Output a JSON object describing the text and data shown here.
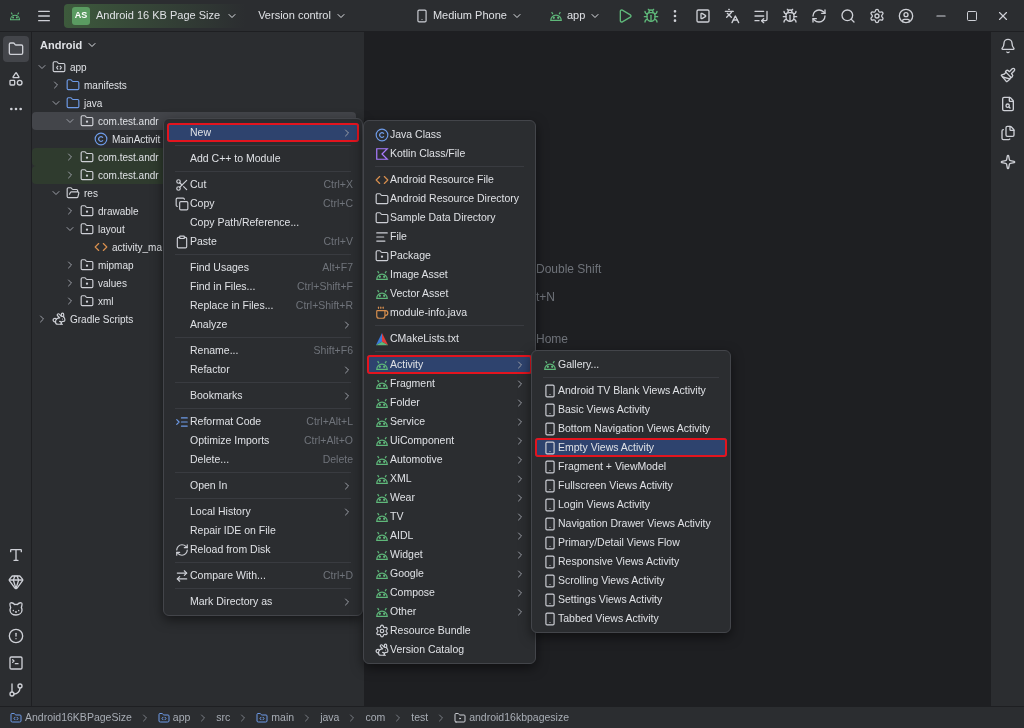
{
  "title_bar": {
    "project_badge": "AS",
    "project_name": "Android 16 KB Page Size",
    "vcs": "Version control",
    "device": "Medium Phone",
    "run_config": "app"
  },
  "tool_strip": [
    {
      "selected": true
    },
    {
      "selected": false
    },
    {
      "selected": false
    }
  ],
  "project_panel": {
    "view": "Android",
    "tree": [
      {
        "label": "app",
        "kind": "module",
        "expanded": true,
        "selected": false,
        "highlighted": false,
        "children": [
          {
            "label": "manifests",
            "kind": "folder",
            "expanded": false,
            "selected": false,
            "highlighted": false
          },
          {
            "label": "java",
            "kind": "folder",
            "expanded": true,
            "selected": false,
            "highlighted": false,
            "children": [
              {
                "label": "com.test.andr",
                "kind": "package",
                "expanded": true,
                "selected": true,
                "highlighted": false,
                "children": [
                  {
                    "label": "MainActivit",
                    "kind": "class",
                    "selected": false,
                    "highlighted": false
                  }
                ]
              },
              {
                "label": "com.test.andr",
                "kind": "package",
                "expanded": false,
                "selected": false,
                "highlighted": true
              },
              {
                "label": "com.test.andr",
                "kind": "package",
                "expanded": false,
                "selected": false,
                "highlighted": true
              }
            ]
          },
          {
            "label": "res",
            "kind": "resfolder",
            "expanded": true,
            "selected": false,
            "highlighted": false,
            "children": [
              {
                "label": "drawable",
                "kind": "package",
                "expanded": false,
                "selected": false,
                "highlighted": false
              },
              {
                "label": "layout",
                "kind": "package",
                "expanded": true,
                "selected": false,
                "highlighted": false,
                "children": [
                  {
                    "label": "activity_ma",
                    "kind": "xml",
                    "selected": false,
                    "highlighted": false
                  }
                ]
              },
              {
                "label": "mipmap",
                "kind": "package",
                "expanded": false,
                "selected": false,
                "highlighted": false
              },
              {
                "label": "values",
                "kind": "package",
                "expanded": false,
                "selected": false,
                "highlighted": false
              },
              {
                "label": "xml",
                "kind": "package",
                "expanded": false,
                "selected": false,
                "highlighted": false
              }
            ]
          }
        ]
      },
      {
        "label": "Gradle Scripts",
        "kind": "gradle",
        "expanded": false,
        "selected": false,
        "highlighted": false
      }
    ]
  },
  "editor_hints": [
    "Double Shift",
    "t+N",
    "Home"
  ],
  "menus": [
    {
      "sections": [
        {
          "items": [
            {
              "label": "New",
              "submenu": true,
              "selected": true,
              "outlined": true
            }
          ]
        },
        {
          "items": [
            {
              "label": "Add C++ to Module",
              "submenu": false,
              "selected": false,
              "outlined": false
            }
          ]
        },
        {
          "items": [
            {
              "label": "Cut",
              "shortcut": "Ctrl+X",
              "kind": "scissors",
              "submenu": false,
              "selected": false,
              "outlined": false
            },
            {
              "label": "Copy",
              "shortcut": "Ctrl+C",
              "kind": "copy",
              "submenu": false,
              "selected": false,
              "outlined": false
            },
            {
              "label": "Copy Path/Reference...",
              "submenu": false,
              "selected": false,
              "outlined": false
            },
            {
              "label": "Paste",
              "shortcut": "Ctrl+V",
              "kind": "paste",
              "submenu": false,
              "selected": false,
              "outlined": false
            }
          ]
        },
        {
          "items": [
            {
              "label": "Find Usages",
              "shortcut": "Alt+F7",
              "submenu": false,
              "selected": false,
              "outlined": false
            },
            {
              "label": "Find in Files...",
              "shortcut": "Ctrl+Shift+F",
              "submenu": false,
              "selected": false,
              "outlined": false
            },
            {
              "label": "Replace in Files...",
              "shortcut": "Ctrl+Shift+R",
              "submenu": false,
              "selected": false,
              "outlined": false
            },
            {
              "label": "Analyze",
              "submenu": true,
              "selected": false,
              "outlined": false
            }
          ]
        },
        {
          "items": [
            {
              "label": "Rename...",
              "shortcut": "Shift+F6",
              "submenu": false,
              "selected": false,
              "outlined": false
            },
            {
              "label": "Refactor",
              "submenu": true,
              "selected": false,
              "outlined": false
            }
          ]
        },
        {
          "items": [
            {
              "label": "Bookmarks",
              "submenu": true,
              "selected": false,
              "outlined": false
            }
          ]
        },
        {
          "items": [
            {
              "label": "Reformat Code",
              "shortcut": "Ctrl+Alt+L",
              "kind": "reformat",
              "submenu": false,
              "selected": false,
              "outlined": false
            },
            {
              "label": "Optimize Imports",
              "shortcut": "Ctrl+Alt+O",
              "submenu": false,
              "selected": false,
              "outlined": false
            },
            {
              "label": "Delete...",
              "shortcut": "Delete",
              "submenu": false,
              "selected": false,
              "outlined": false
            }
          ]
        },
        {
          "items": [
            {
              "label": "Open In",
              "submenu": true,
              "selected": false,
              "outlined": false
            }
          ]
        },
        {
          "items": [
            {
              "label": "Local History",
              "submenu": true,
              "selected": false,
              "outlined": false
            },
            {
              "label": "Repair IDE on File",
              "submenu": false,
              "selected": false,
              "outlined": false
            },
            {
              "label": "Reload from Disk",
              "kind": "reload",
              "submenu": false,
              "selected": false,
              "outlined": false
            }
          ]
        },
        {
          "items": [
            {
              "label": "Compare With...",
              "shortcut": "Ctrl+D",
              "kind": "compare",
              "submenu": false,
              "selected": false,
              "outlined": false
            }
          ]
        },
        {
          "items": [
            {
              "label": "Mark Directory as",
              "submenu": true,
              "selected": false,
              "outlined": false
            }
          ]
        }
      ]
    },
    {
      "sections": [
        {
          "items": [
            {
              "label": "Java Class",
              "kind": "class",
              "submenu": false,
              "selected": false,
              "outlined": false
            },
            {
              "label": "Kotlin Class/File",
              "kind": "kotlin",
              "submenu": false,
              "selected": false,
              "outlined": false
            }
          ]
        },
        {
          "items": [
            {
              "label": "Android Resource File",
              "kind": "xml",
              "submenu": false,
              "selected": false,
              "outlined": false
            },
            {
              "label": "Android Resource Directory",
              "kind": "folder",
              "submenu": false,
              "selected": false,
              "outlined": false
            },
            {
              "label": "Sample Data Directory",
              "kind": "folder",
              "submenu": false,
              "selected": false,
              "outlined": false
            },
            {
              "label": "File",
              "kind": "file",
              "submenu": false,
              "selected": false,
              "outlined": false
            },
            {
              "label": "Package",
              "kind": "package",
              "submenu": false,
              "selected": false,
              "outlined": false
            },
            {
              "label": "Image Asset",
              "kind": "android",
              "submenu": false,
              "selected": false,
              "outlined": false
            },
            {
              "label": "Vector Asset",
              "kind": "android",
              "submenu": false,
              "selected": false,
              "outlined": false
            },
            {
              "label": "module-info.java",
              "kind": "java",
              "submenu": false,
              "selected": false,
              "outlined": false
            }
          ]
        },
        {
          "items": [
            {
              "label": "CMakeLists.txt",
              "kind": "cmake",
              "submenu": false,
              "selected": false,
              "outlined": false
            }
          ]
        },
        {
          "items": [
            {
              "label": "Activity",
              "kind": "android",
              "submenu": true,
              "selected": true,
              "outlined": true
            },
            {
              "label": "Fragment",
              "kind": "android",
              "submenu": true,
              "selected": false,
              "outlined": false
            },
            {
              "label": "Folder",
              "kind": "android",
              "submenu": true,
              "selected": false,
              "outlined": false
            },
            {
              "label": "Service",
              "kind": "android",
              "submenu": true,
              "selected": false,
              "outlined": false
            },
            {
              "label": "UiComponent",
              "kind": "android",
              "submenu": true,
              "selected": false,
              "outlined": false
            },
            {
              "label": "Automotive",
              "kind": "android",
              "submenu": true,
              "selected": false,
              "outlined": false
            },
            {
              "label": "XML",
              "kind": "android",
              "submenu": true,
              "selected": false,
              "outlined": false
            },
            {
              "label": "Wear",
              "kind": "android",
              "submenu": true,
              "selected": false,
              "outlined": false
            },
            {
              "label": "TV",
              "kind": "android",
              "submenu": true,
              "selected": false,
              "outlined": false
            },
            {
              "label": "AIDL",
              "kind": "android",
              "submenu": true,
              "selected": false,
              "outlined": false
            },
            {
              "label": "Widget",
              "kind": "android",
              "submenu": true,
              "selected": false,
              "outlined": false
            },
            {
              "label": "Google",
              "kind": "android",
              "submenu": true,
              "selected": false,
              "outlined": false
            },
            {
              "label": "Compose",
              "kind": "android",
              "submenu": true,
              "selected": false,
              "outlined": false
            },
            {
              "label": "Other",
              "kind": "android",
              "submenu": true,
              "selected": false,
              "outlined": false
            },
            {
              "label": "Resource Bundle",
              "kind": "gear",
              "submenu": false,
              "selected": false,
              "outlined": false
            },
            {
              "label": "Version Catalog",
              "kind": "gradle",
              "submenu": false,
              "selected": false,
              "outlined": false
            }
          ]
        }
      ]
    },
    {
      "sections": [
        {
          "items": [
            {
              "label": "Gallery...",
              "kind": "android",
              "submenu": false,
              "selected": false,
              "outlined": false
            }
          ]
        },
        {
          "items": [
            {
              "label": "Android TV Blank Views Activity",
              "kind": "phone",
              "submenu": false,
              "selected": false,
              "outlined": false
            },
            {
              "label": "Basic Views Activity",
              "kind": "phone",
              "submenu": false,
              "selected": false,
              "outlined": false
            },
            {
              "label": "Bottom Navigation Views Activity",
              "kind": "phone",
              "submenu": false,
              "selected": false,
              "outlined": false
            },
            {
              "label": "Empty Views Activity",
              "kind": "phone",
              "submenu": false,
              "selected": true,
              "outlined": true
            },
            {
              "label": "Fragment + ViewModel",
              "kind": "phone",
              "submenu": false,
              "selected": false,
              "outlined": false
            },
            {
              "label": "Fullscreen Views Activity",
              "kind": "phone",
              "submenu": false,
              "selected": false,
              "outlined": false
            },
            {
              "label": "Login Views Activity",
              "kind": "phone",
              "submenu": false,
              "selected": false,
              "outlined": false
            },
            {
              "label": "Navigation Drawer Views Activity",
              "kind": "phone",
              "submenu": false,
              "selected": false,
              "outlined": false
            },
            {
              "label": "Primary/Detail Views Flow",
              "kind": "phone",
              "submenu": false,
              "selected": false,
              "outlined": false
            },
            {
              "label": "Responsive Views Activity",
              "kind": "phone",
              "submenu": false,
              "selected": false,
              "outlined": false
            },
            {
              "label": "Scrolling Views Activity",
              "kind": "phone",
              "submenu": false,
              "selected": false,
              "outlined": false
            },
            {
              "label": "Settings Views Activity",
              "kind": "phone",
              "submenu": false,
              "selected": false,
              "outlined": false
            },
            {
              "label": "Tabbed Views Activity",
              "kind": "phone",
              "submenu": false,
              "selected": false,
              "outlined": false
            }
          ]
        }
      ]
    }
  ],
  "breadcrumbs": [
    {
      "label": "Android16KBPageSize",
      "kind": "module"
    },
    {
      "label": "app",
      "kind": "module"
    },
    {
      "label": "src"
    },
    {
      "label": "main",
      "kind": "module"
    },
    {
      "label": "java"
    },
    {
      "label": "com"
    },
    {
      "label": "test"
    },
    {
      "label": "android16kbpagesize",
      "kind": "folder"
    }
  ]
}
